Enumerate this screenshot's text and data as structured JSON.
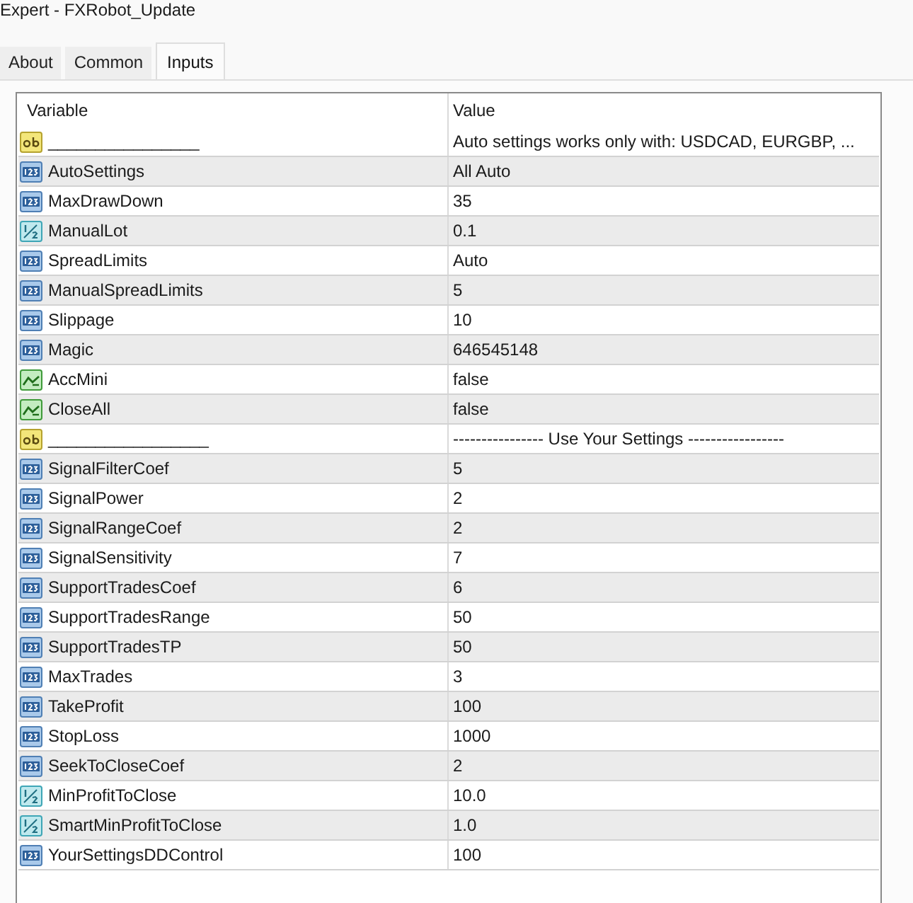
{
  "window": {
    "title": "Expert - FXRobot_Update"
  },
  "tabs": [
    {
      "label": "About",
      "selected": false
    },
    {
      "label": "Common",
      "selected": false
    },
    {
      "label": "Inputs",
      "selected": true
    }
  ],
  "table": {
    "columns": [
      "Variable",
      "Value"
    ],
    "rows": [
      {
        "kind": "string",
        "variable": "________________",
        "value": "Auto settings works only with: USDCAD, EURGBP, ..."
      },
      {
        "kind": "int",
        "variable": "AutoSettings",
        "value": "All Auto"
      },
      {
        "kind": "int",
        "variable": "MaxDrawDown",
        "value": "35"
      },
      {
        "kind": "double",
        "variable": "ManualLot",
        "value": "0.1"
      },
      {
        "kind": "int",
        "variable": "SpreadLimits",
        "value": "Auto"
      },
      {
        "kind": "int",
        "variable": "ManualSpreadLimits",
        "value": "5"
      },
      {
        "kind": "int",
        "variable": "Slippage",
        "value": "10"
      },
      {
        "kind": "int",
        "variable": "Magic",
        "value": "646545148"
      },
      {
        "kind": "bool",
        "variable": "AccMini",
        "value": "false"
      },
      {
        "kind": "bool",
        "variable": "CloseAll",
        "value": "false"
      },
      {
        "kind": "string",
        "variable": "_________________",
        "value": "---------------- Use Your Settings -----------------"
      },
      {
        "kind": "int",
        "variable": "SignalFilterCoef",
        "value": "5"
      },
      {
        "kind": "int",
        "variable": "SignalPower",
        "value": "2"
      },
      {
        "kind": "int",
        "variable": "SignalRangeCoef",
        "value": "2"
      },
      {
        "kind": "int",
        "variable": "SignalSensitivity",
        "value": "7"
      },
      {
        "kind": "int",
        "variable": "SupportTradesCoef",
        "value": "6"
      },
      {
        "kind": "int",
        "variable": "SupportTradesRange",
        "value": "50"
      },
      {
        "kind": "int",
        "variable": "SupportTradesTP",
        "value": "50"
      },
      {
        "kind": "int",
        "variable": "MaxTrades",
        "value": "3"
      },
      {
        "kind": "int",
        "variable": "TakeProfit",
        "value": "100"
      },
      {
        "kind": "int",
        "variable": "StopLoss",
        "value": "1000"
      },
      {
        "kind": "int",
        "variable": "SeekToCloseCoef",
        "value": "2"
      },
      {
        "kind": "double",
        "variable": "MinProfitToClose",
        "value": "10.0"
      },
      {
        "kind": "double",
        "variable": "SmartMinProfitToClose",
        "value": "1.0"
      },
      {
        "kind": "int",
        "variable": "YourSettingsDDControl",
        "value": "100"
      }
    ]
  }
}
